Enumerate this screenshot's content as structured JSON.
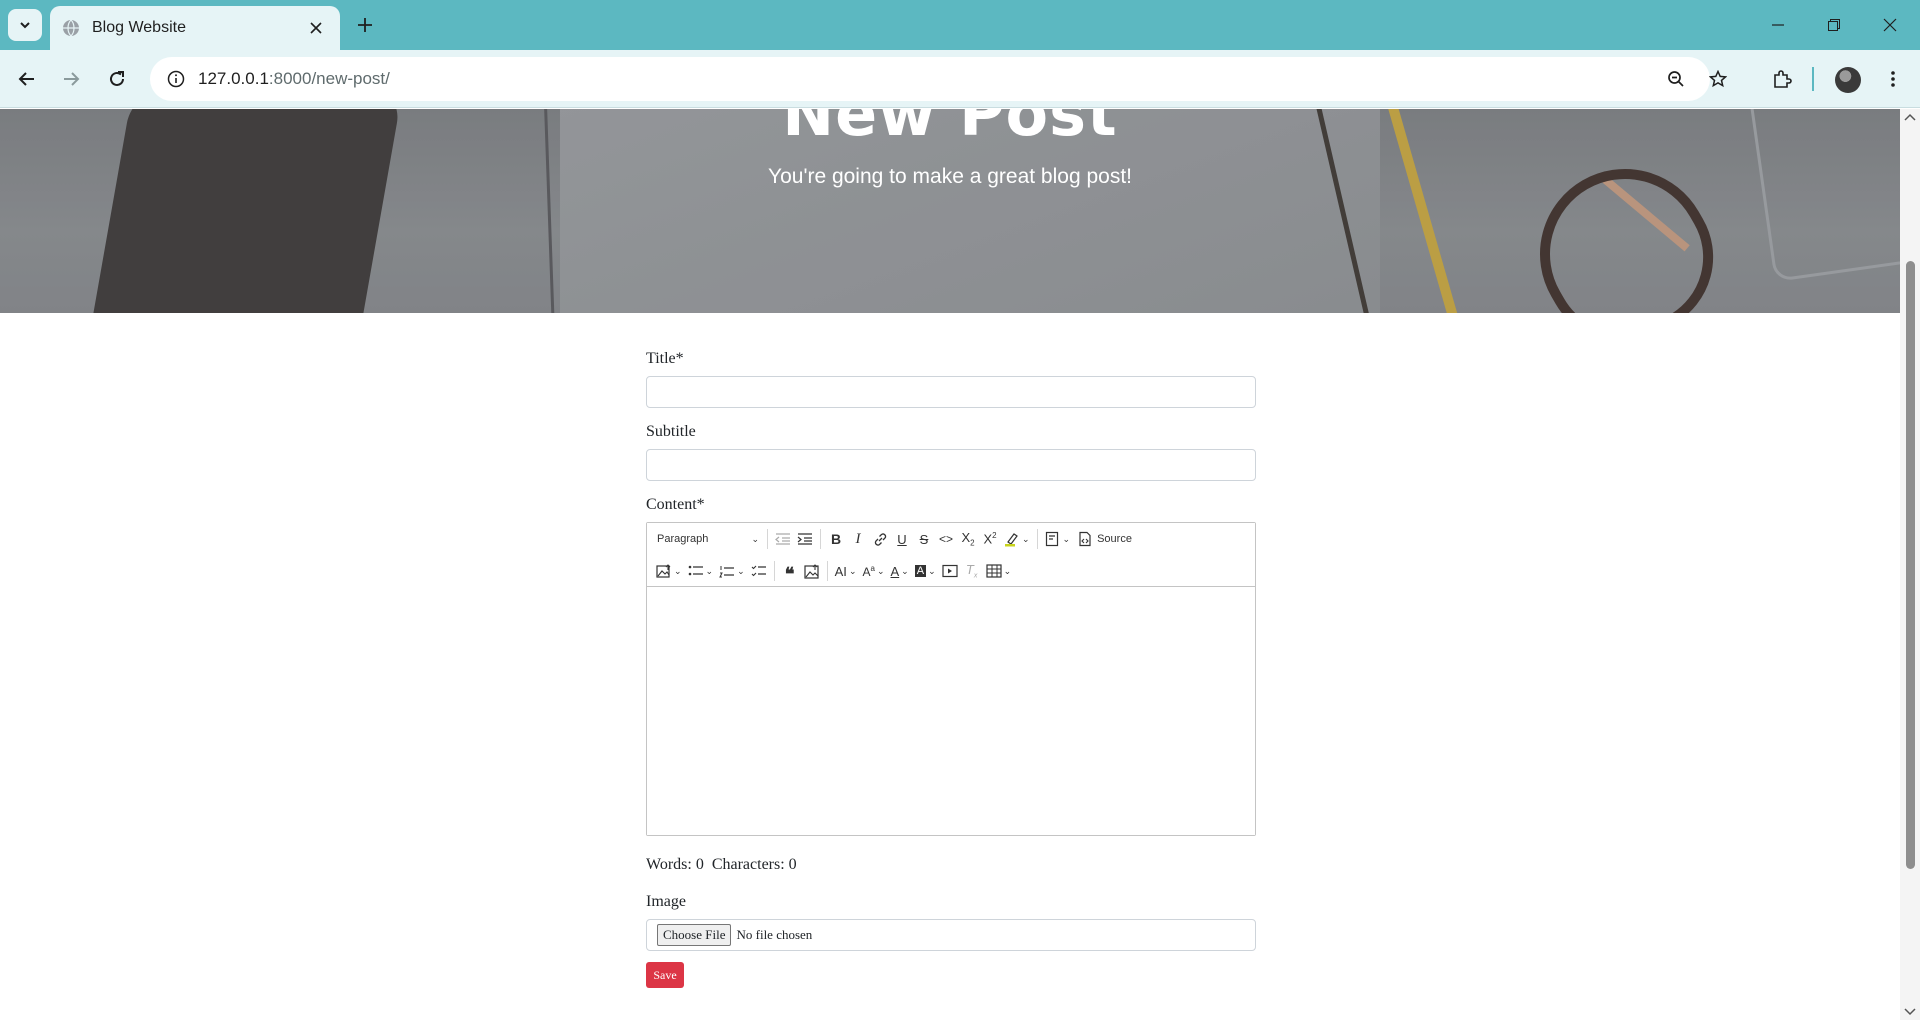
{
  "browser": {
    "tab_title": "Blog Website",
    "url_host": "127.0.0.1",
    "url_path": ":8000/new-post/",
    "accent_color": "#5cb8c1"
  },
  "hero": {
    "title": "New Post",
    "subtitle": "You're going to make a great blog post!"
  },
  "form": {
    "title_label": "Title*",
    "title_value": "",
    "subtitle_label": "Subtitle",
    "subtitle_value": "",
    "content_label": "Content*",
    "editor": {
      "paragraph_select": "Paragraph",
      "source_label": "Source",
      "toolbar_row1": [
        "outdent-icon",
        "indent-icon",
        "bold-icon",
        "italic-icon",
        "link-icon",
        "underline-icon",
        "strikethrough-icon",
        "code-icon",
        "subscript-icon",
        "superscript-icon",
        "highlight-icon",
        "insert-template-icon",
        "source-icon"
      ],
      "toolbar_row2": [
        "insert-image-icon",
        "bulleted-list-icon",
        "numbered-list-icon",
        "todo-list-icon",
        "blockquote-icon",
        "upload-image-icon",
        "font-size-icon",
        "font-family-icon",
        "font-color-icon",
        "font-background-icon",
        "media-embed-icon",
        "remove-format-icon",
        "table-icon"
      ]
    },
    "words_label": "Words: 0",
    "characters_label": "Characters: 0",
    "image_label": "Image",
    "choose_file_label": "Choose File",
    "no_file_text": "No file chosen",
    "save_label": "Save",
    "save_color": "#dc3545"
  }
}
